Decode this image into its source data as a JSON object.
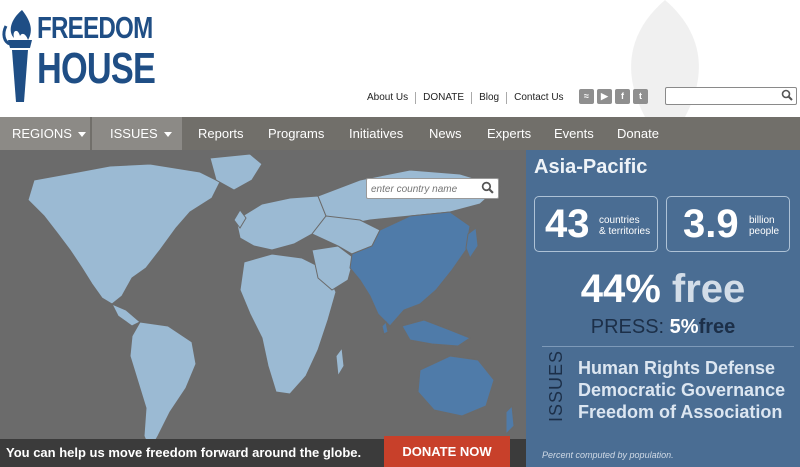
{
  "header": {
    "logo_line1": "FREEDOM",
    "logo_line2": "HOUSE",
    "top_links": [
      "About Us",
      "DONATE",
      "Blog",
      "Contact Us"
    ],
    "social_icons": [
      "rss-icon",
      "youtube-icon",
      "facebook-icon",
      "twitter-icon"
    ],
    "search_placeholder": ""
  },
  "nav": {
    "regions": "REGIONS",
    "issues": "ISSUES",
    "items": [
      "Reports",
      "Programs",
      "Initiatives",
      "News",
      "Experts",
      "Events",
      "Donate"
    ]
  },
  "map": {
    "search_placeholder": "enter country name",
    "bottom_message": "You can help us move freedom forward around the globe.",
    "donate_button": "DONATE NOW"
  },
  "panel": {
    "title": "Asia-Pacific",
    "countries_value": "43",
    "countries_unit_1": "countries",
    "countries_unit_2": "& territories",
    "people_value": "3.9",
    "people_unit_1": "billion",
    "people_unit_2": "people",
    "free_pct": "44%",
    "free_word": "free",
    "press_label": "PRESS:",
    "press_pct": "5%",
    "press_word": "free",
    "issues_label": "ISSUES",
    "issues": [
      "Human Rights Defense",
      "Democratic Governance",
      "Freedom of Association"
    ],
    "footnote": "Percent computed by population."
  },
  "colors": {
    "brand": "#1f4e85",
    "nav": "#716f6a",
    "panel": "#4a6d93",
    "map_ocean": "#6b6b6b",
    "map_land": "#9bbad3",
    "map_highlight": "#4f7ba9",
    "donate": "#c8402a"
  }
}
